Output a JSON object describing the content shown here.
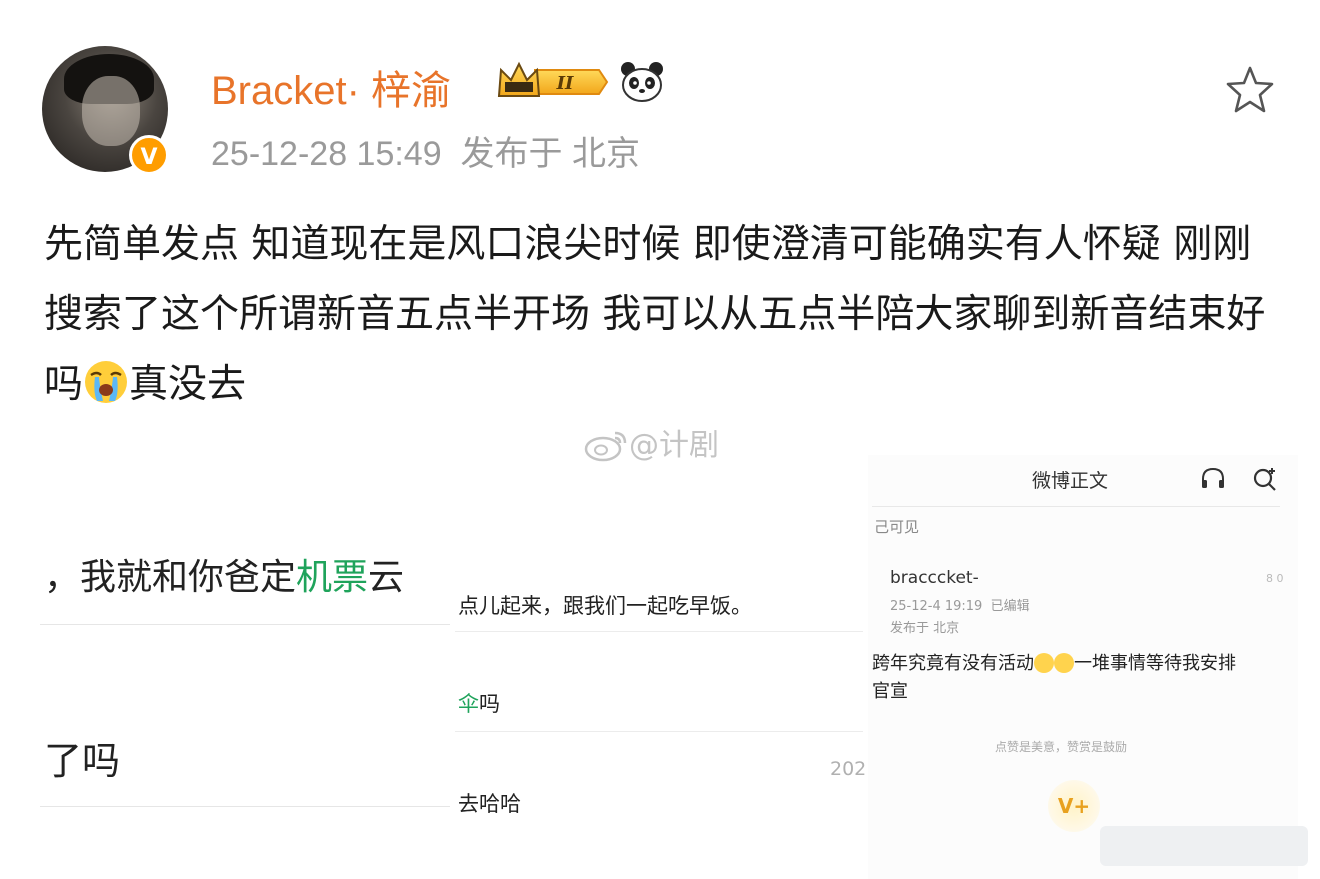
{
  "post": {
    "username": "Bracket· 梓渝",
    "crown_level": "II",
    "verified_badge": "V",
    "timestamp": "25-12-28 15:49",
    "published_from": "发布于 北京",
    "content_part1": "先简单发点 知道现在是风口浪尖时候 即使澄清可能确实有人怀疑 刚刚搜索了这个所谓新音五点半开场 我可以从五点半陪大家聊到新音结束好吗",
    "content_part2": "真没去",
    "watermark": "@计剧"
  },
  "icons": {
    "favorite": "star-outline-icon",
    "crying_emoji": "crying-face-icon",
    "panda_emoji": "panda-icon",
    "crown_badge": "crown-level-icon",
    "weibo_logo": "weibo-logo-icon"
  },
  "left_fragment": {
    "line1_prefix": "，我就和你爸定",
    "line1_green": "机票",
    "line1_suffix": "云",
    "line2": "了吗"
  },
  "middle_fragment": {
    "line1": "点儿起来，跟我们一起吃早饭。",
    "line2_green": "伞",
    "line2_rest": "吗",
    "line3": "去哈哈",
    "year_cut": "202"
  },
  "right_fragment": {
    "title": "微博正文",
    "visibility": "己可见",
    "user": "bracccket-",
    "date": "25-12-4 19:19",
    "edited": "已编辑",
    "location": "发布于 北京",
    "right_cut": "8\n0",
    "body_line1_a": "跨年究竟有没有活动",
    "body_line1_b": "一堆事情等待我安排",
    "body_line2": "官宣",
    "like_text": "点赞是美意，赞赏是鼓励",
    "reward_label": "V+"
  },
  "colors": {
    "username": "#e8742a",
    "meta": "#9a9a9a",
    "green_highlight": "#1fa35b",
    "badge_orange": "#ff9d00"
  }
}
